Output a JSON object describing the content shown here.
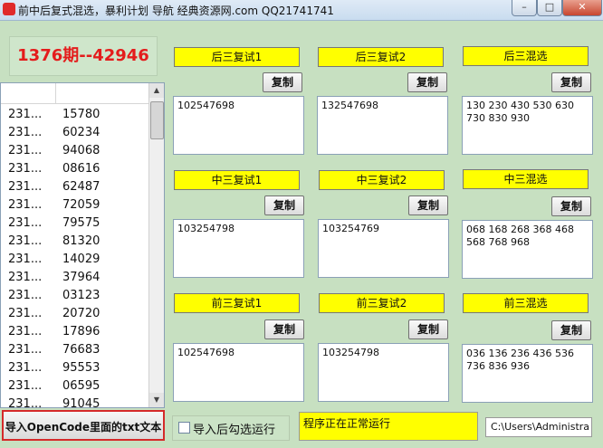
{
  "window": {
    "title": "前中后复式混选，暴利计划 导航 经典资源网.com QQ21741741",
    "controls": {
      "minimize": "–",
      "maximize": "□",
      "close": "✕"
    }
  },
  "period_label": "1376期--42946",
  "history": [
    {
      "issue": "231...",
      "number": "15780"
    },
    {
      "issue": "231...",
      "number": "60234"
    },
    {
      "issue": "231...",
      "number": "94068"
    },
    {
      "issue": "231...",
      "number": "08616"
    },
    {
      "issue": "231...",
      "number": "62487"
    },
    {
      "issue": "231...",
      "number": "72059"
    },
    {
      "issue": "231...",
      "number": "79575"
    },
    {
      "issue": "231...",
      "number": "81320"
    },
    {
      "issue": "231...",
      "number": "14029"
    },
    {
      "issue": "231...",
      "number": "37964"
    },
    {
      "issue": "231...",
      "number": "03123"
    },
    {
      "issue": "231...",
      "number": "20720"
    },
    {
      "issue": "231...",
      "number": "17896"
    },
    {
      "issue": "231...",
      "number": "76683"
    },
    {
      "issue": "231...",
      "number": "95553"
    },
    {
      "issue": "231...",
      "number": "06595"
    },
    {
      "issue": "231...",
      "number": "91045"
    }
  ],
  "copy_label": "复制",
  "panels": {
    "hou3_fushi1": {
      "label": "后三复试1",
      "text": "102547698"
    },
    "hou3_fushi2": {
      "label": "后三复试2",
      "text": "132547698"
    },
    "hou3_hunxuan": {
      "label": "后三混选",
      "text": "130 230 430 530 630 730 830 930"
    },
    "zhong3_fushi1": {
      "label": "中三复试1",
      "text": "103254798"
    },
    "zhong3_fushi2": {
      "label": "中三复试2",
      "text": "103254769"
    },
    "zhong3_hunxuan": {
      "label": "中三混选",
      "text": "068 168 268 368 468 568 768 968"
    },
    "qian3_fushi1": {
      "label": "前三复试1",
      "text": "102547698"
    },
    "qian3_fushi2": {
      "label": "前三复试2",
      "text": "103254798"
    },
    "qian3_hunxuan": {
      "label": "前三混选",
      "text": "036 136 236 436 536 736 836 936"
    }
  },
  "bottom": {
    "import_button": "导入OpenCode里面的txt文本",
    "auto_run_label": "导入后勾选运行",
    "auto_run_checked": false,
    "status_text": "程序正在正常运行",
    "path_text": "C:\\Users\\Administra"
  },
  "colors": {
    "background": "#c7e0c1",
    "label_yellow": "#ffff00",
    "period_red": "#e41c1c",
    "import_border": "#d52a2a"
  }
}
